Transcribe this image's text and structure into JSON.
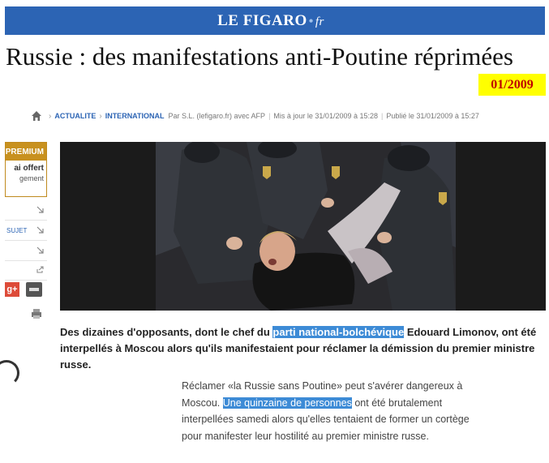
{
  "header": {
    "logo_main": "LE FIGARO",
    "logo_dot": "•",
    "logo_suffix": "fr"
  },
  "article": {
    "title": "Russie : des manifestations anti-Poutine réprimées",
    "date_badge": "01/2009",
    "breadcrumb": {
      "section1": "ACTUALITE",
      "section2": "INTERNATIONAL",
      "author": "Par S.L. (lefigaro.fr) avec AFP",
      "updated": "Mis à jour le 31/01/2009 à 15:28",
      "published": "Publié le 31/01/2009 à 15:27"
    },
    "lede_before": "Des dizaines d'opposants, dont le chef du ",
    "lede_highlight": "parti national-bolchévique",
    "lede_after": " Edouard Limonov, ont été interpellés à Moscou alors qu'ils manifestaient pour réclamer la démission du premier ministre russe.",
    "body_before": "Réclamer «la Russie sans Poutine» peut s'avérer dangereux à Moscou. ",
    "body_highlight": "Une quinzaine de personnes",
    "body_after": " ont été brutalement interpellées samedi alors qu'elles tentaient de former un cortège pour manifester leur hostilité au premier ministre russe."
  },
  "sidebar": {
    "premium_label": "PREMIUM",
    "premium_line1": "ai offert",
    "premium_line2": "gement",
    "row_sujet": "SUJET",
    "gplus_label": "g+"
  },
  "colors": {
    "brand_blue": "#2c64b4",
    "badge_yellow": "#ffff00",
    "badge_text": "#c00000",
    "premium_gold": "#c8911f",
    "highlight": "#3d8bd6"
  },
  "icons": [
    "home-icon",
    "arrow-icon",
    "share-icon",
    "mail-icon",
    "print-icon",
    "gplus-icon"
  ]
}
